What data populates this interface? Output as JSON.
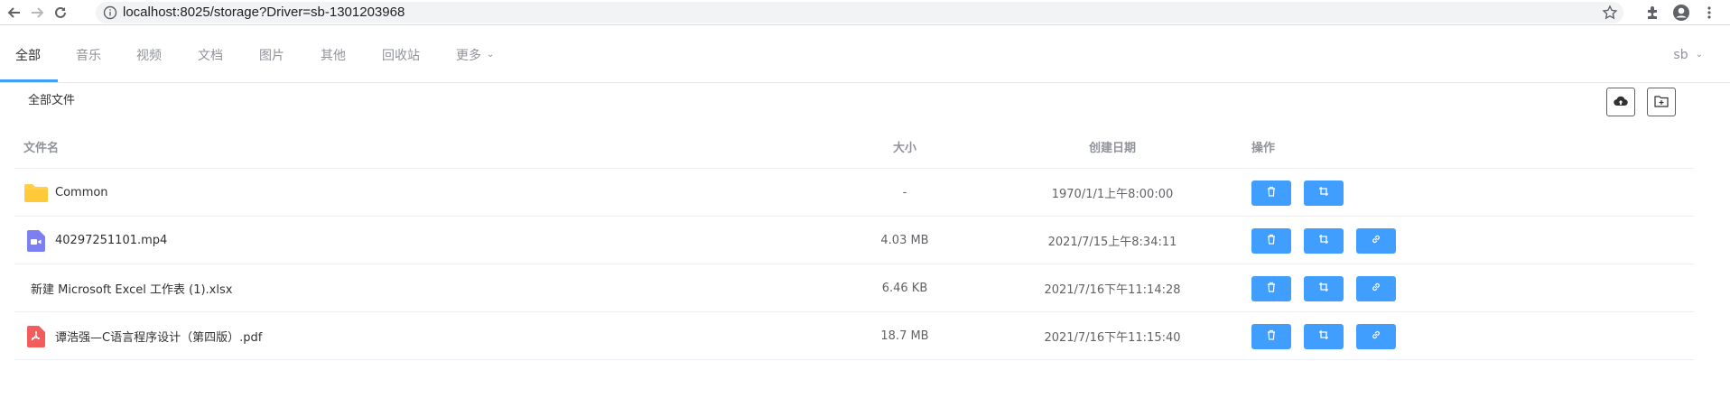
{
  "browser": {
    "url": "localhost:8025/storage?Driver=sb-1301203968"
  },
  "nav": {
    "tabs": [
      {
        "label": "全部"
      },
      {
        "label": "音乐"
      },
      {
        "label": "视频"
      },
      {
        "label": "文档"
      },
      {
        "label": "图片"
      },
      {
        "label": "其他"
      },
      {
        "label": "回收站"
      },
      {
        "label": "更多"
      }
    ],
    "active_tab": "全部",
    "user": "sb"
  },
  "breadcrumb": "全部文件",
  "table": {
    "columns": {
      "name": "文件名",
      "size": "大小",
      "date": "创建日期",
      "ops": "操作"
    },
    "rows": [
      {
        "name": "Common",
        "size": "-",
        "date": "1970/1/1上午8:00:00",
        "type": "folder-icon"
      },
      {
        "name": "40297251101.mp4",
        "size": "4.03 MB",
        "date": "2021/7/15上午8:34:11",
        "type": "video-file-icon"
      },
      {
        "name": "新建 Microsoft Excel 工作表 (1).xlsx",
        "size": "6.46 KB",
        "date": "2021/7/16下午11:14:28",
        "type": "none"
      },
      {
        "name": "谭浩强—C语言程序设计（第四版）.pdf",
        "size": "18.7 MB",
        "date": "2021/7/16下午11:15:40",
        "type": "pdf-file-icon"
      }
    ]
  },
  "colors": {
    "accent": "#409eff",
    "folder": "#ffd04b",
    "video": "#7b7ff0",
    "pdf": "#f25c5c"
  }
}
